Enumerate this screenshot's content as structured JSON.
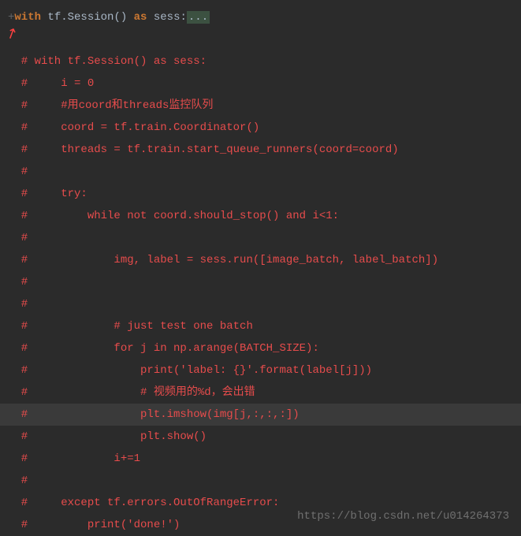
{
  "header": {
    "gutter": "+",
    "kw_with": "with",
    "tf_session": " tf.Session",
    "parens": "()",
    "space": " ",
    "kw_as": "as",
    "sess_colon": " sess:",
    "fold": "..."
  },
  "arrow": "↗",
  "lines": [
    "  # with tf.Session() as sess:",
    "  #     i = 0",
    "  #     #用coord和threads监控队列",
    "  #     coord = tf.train.Coordinator()",
    "  #     threads = tf.train.start_queue_runners(coord=coord)",
    "  #",
    "  #     try:",
    "  #         while not coord.should_stop() and i<1:",
    "  #",
    "  #             img, label = sess.run([image_batch, label_batch])",
    "  #",
    "  #",
    "  #             # just test one batch",
    "  #             for j in np.arange(BATCH_SIZE):",
    "  #                 print('label: {}'.format(label[j]))",
    "  #                 # 视频用的%d，会出错",
    "  #                 plt.imshow(img[j,:,:,:])",
    "  #                 plt.show()",
    "  #             i+=1",
    "  #",
    "  #     except tf.errors.OutOfRangeError:",
    "  #         print('done!')"
  ],
  "highlight_index": 16,
  "watermark": "https://blog.csdn.net/u014264373"
}
